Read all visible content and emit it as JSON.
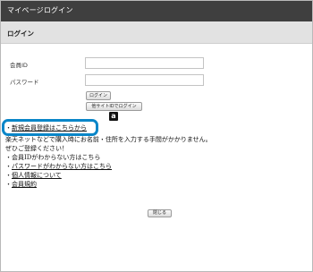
{
  "window": {
    "title": "マイページログイン"
  },
  "section": {
    "title": "ログイン"
  },
  "form": {
    "member_id_label": "会員ID",
    "password_label": "パスワード",
    "member_id_value": "",
    "password_value": "",
    "login_button": "ログイン",
    "amazon_login_button": "他サイトIDでログイン",
    "amazon_icon_glyph": "a"
  },
  "links": {
    "new_member": "新規会員登録はこちらから",
    "note_line1": "楽天ネットなどで購入時にお名前・住所を入力する手間がかかりません。",
    "note_line2": "ぜひご登録ください！",
    "forgot_id": "会員IDがわからない方はこちら",
    "forgot_password": "パスワードがわからない方はこちら",
    "privacy": "個人情報について",
    "terms": "会員規約",
    "bullet": "・"
  },
  "footer": {
    "close_button": "閉じる"
  },
  "colors": {
    "titlebar": "#3f3f3f",
    "highlight": "#0a86c8",
    "header": "#e2e2e2"
  },
  "icons": {
    "amazon": "amazon-icon"
  }
}
